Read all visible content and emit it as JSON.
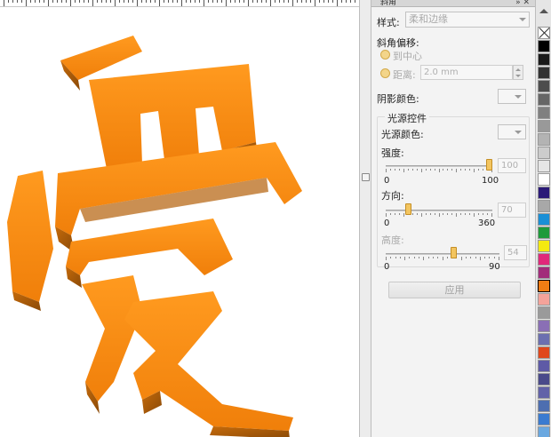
{
  "docker": {
    "title": "斜角",
    "style_label": "样式:",
    "style_value": "柔和边缘",
    "bevel_offset_label": "斜角偏移:",
    "to_center_label": "到中心",
    "distance_label": "距离:",
    "distance_value": "2.0 mm",
    "shadow_color_label": "阴影颜色:",
    "light_group_title": "光源控件",
    "light_color_label": "光源颜色:",
    "intensity": {
      "label": "强度:",
      "min": "0",
      "max": "100",
      "value": "100",
      "fraction": 1.0
    },
    "direction": {
      "label": "方向:",
      "min": "0",
      "max": "360",
      "value": "70",
      "fraction": 0.194
    },
    "altitude": {
      "label": "高度:",
      "min": "0",
      "max": "90",
      "value": "54",
      "fraction": 0.6
    },
    "apply_label": "应用"
  },
  "canvas": {
    "artwork_name": "爱",
    "fill_color": "#f58a0c"
  },
  "palette": {
    "colors": [
      "nocolor",
      "#000000",
      "#1a1a1a",
      "#333333",
      "#4d4d4d",
      "#666666",
      "#808080",
      "#999999",
      "#b3b3b3",
      "#cccccc",
      "#e6e6e6",
      "#ffffff",
      "#2b1a78",
      "#a8a8a8",
      "#1a8fd6",
      "#1e9a3a",
      "#f4ea10",
      "#e0287a",
      "#a22c7a",
      "#f07d14",
      "#f4a39a",
      "#9a9a9a",
      "#8a6fb5",
      "#6b6fb0",
      "#e0471b",
      "#5e5aa6",
      "#4a4a8a",
      "#6262a8",
      "#4d6eb0",
      "#3a7bd0",
      "#6aa8e0"
    ],
    "selected_index": 19
  }
}
